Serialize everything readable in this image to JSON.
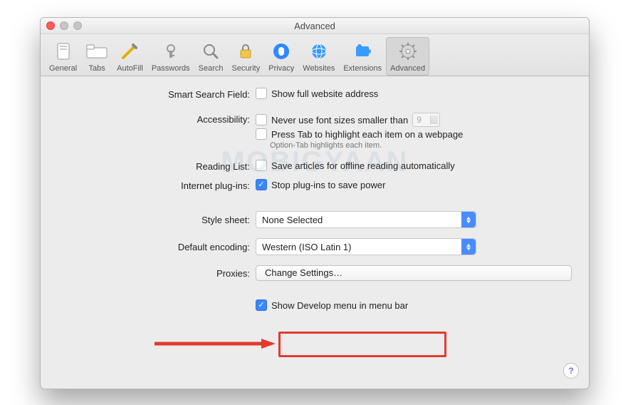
{
  "window": {
    "title": "Advanced"
  },
  "toolbar": {
    "items": [
      {
        "id": "general",
        "label": "General"
      },
      {
        "id": "tabs",
        "label": "Tabs"
      },
      {
        "id": "autofill",
        "label": "AutoFill"
      },
      {
        "id": "passwords",
        "label": "Passwords"
      },
      {
        "id": "search",
        "label": "Search"
      },
      {
        "id": "security",
        "label": "Security"
      },
      {
        "id": "privacy",
        "label": "Privacy"
      },
      {
        "id": "websites",
        "label": "Websites"
      },
      {
        "id": "extensions",
        "label": "Extensions"
      },
      {
        "id": "advanced",
        "label": "Advanced",
        "selected": true
      }
    ]
  },
  "watermark": "MOBIGYAAN",
  "labels": {
    "smart_search": "Smart Search Field:",
    "accessibility": "Accessibility:",
    "reading_list": "Reading List:",
    "internet_plugins": "Internet plug-ins:",
    "style_sheet": "Style sheet:",
    "default_encoding": "Default encoding:",
    "proxies": "Proxies:"
  },
  "options": {
    "show_full_url": "Show full website address",
    "never_smaller": "Never use font sizes smaller than",
    "font_size_value": "9",
    "press_tab": "Press Tab to highlight each item on a webpage",
    "option_tab_note": "Option-Tab highlights each item.",
    "save_offline": "Save articles for offline reading automatically",
    "stop_plugins": "Stop plug-ins to save power",
    "style_sheet_value": "None Selected",
    "encoding_value": "Western (ISO Latin 1)",
    "change_settings": "Change Settings…",
    "show_develop": "Show Develop menu in menu bar"
  },
  "checked": {
    "show_full_url": false,
    "never_smaller": false,
    "press_tab": false,
    "save_offline": false,
    "stop_plugins": true,
    "show_develop": true
  },
  "help": "?"
}
